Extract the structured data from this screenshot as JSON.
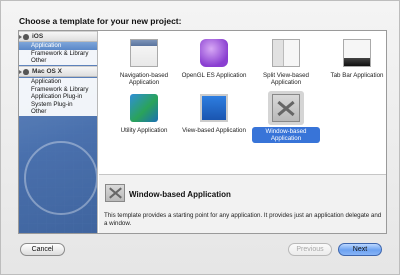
{
  "dialog": {
    "title": "Choose a template for your new project:"
  },
  "sidebar": {
    "sections": [
      {
        "label": "iOS",
        "categories": [
          "Application",
          "Framework & Library",
          "Other"
        ],
        "selected_index": 0
      },
      {
        "label": "Mac OS X",
        "categories": [
          "Application",
          "Framework & Library",
          "Application Plug-in",
          "System Plug-in",
          "Other"
        ]
      }
    ]
  },
  "templates": [
    {
      "label": "Navigation-based Application",
      "icon": "navigation-icon"
    },
    {
      "label": "OpenGL ES Application",
      "icon": "opengl-cube-icon"
    },
    {
      "label": "Split View-based Application",
      "icon": "split-view-icon"
    },
    {
      "label": "Tab Bar Application",
      "icon": "tab-bar-icon"
    },
    {
      "label": "Utility Application",
      "icon": "utility-icon"
    },
    {
      "label": "View-based Application",
      "icon": "view-icon"
    },
    {
      "label": "Window-based Application",
      "icon": "window-icon",
      "selected": true
    }
  ],
  "description": {
    "title": "Window-based Application",
    "text": "This template provides a starting point for any application. It provides just an application delegate and a window."
  },
  "buttons": {
    "cancel": "Cancel",
    "previous": "Previous",
    "next": "Next"
  },
  "colors": {
    "selection": "#3874d8",
    "default_button": "#6da2f1"
  }
}
